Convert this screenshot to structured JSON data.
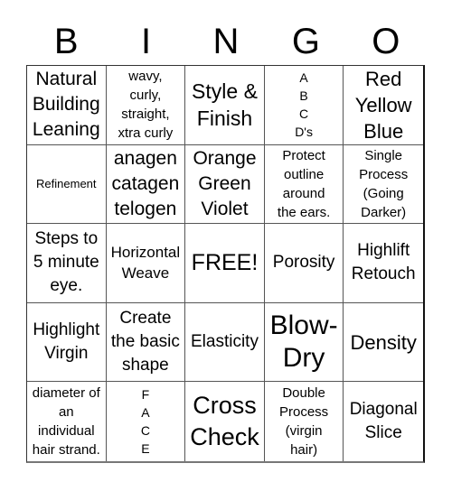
{
  "header": {
    "letters": [
      "B",
      "I",
      "N",
      "G",
      "O"
    ]
  },
  "board": {
    "cells": [
      "Natural\nBuilding\nLeaning",
      "wavy,\ncurly,\nstraight,\nxtra curly",
      "Style &\nFinish",
      "A\nB\nC\nD's",
      "Red\nYellow\nBlue",
      "Refinement",
      "anagen\ncatagen\ntelogen",
      "Orange\nGreen\nViolet",
      "Protect\noutline\naround\nthe ears.",
      "Single\nProcess\n(Going\nDarker)",
      "Steps to\n5 minute\neye.",
      "Horizontal\nWeave",
      "FREE!",
      "Porosity",
      "Highlift\nRetouch",
      "Highlight\nVirgin",
      "Create\nthe basic\nshape",
      "Elasticity",
      "Blow-\nDry",
      "Density",
      "diameter of\nan\nindividual\nhair strand.",
      "F\nA\nC\nE",
      "Cross\nCheck",
      "Double\nProcess\n(virgin\nhair)",
      "Diagonal\nSlice"
    ]
  }
}
